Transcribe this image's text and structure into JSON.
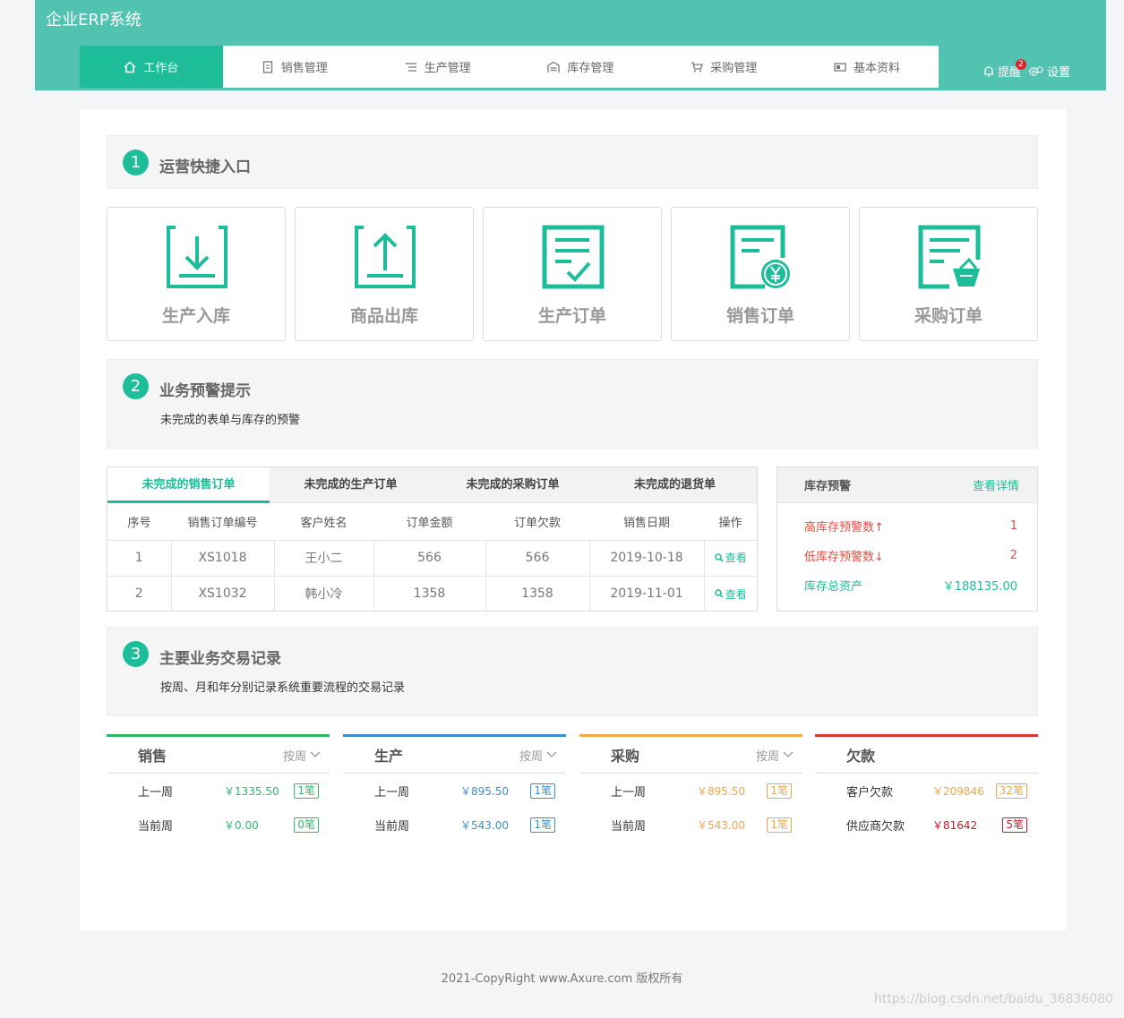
{
  "app": {
    "title": "企业ERP系统"
  },
  "nav": {
    "items": [
      {
        "label": "工作台",
        "icon": "home-icon"
      },
      {
        "label": "销售管理",
        "icon": "document-icon"
      },
      {
        "label": "生产管理",
        "icon": "list-icon"
      },
      {
        "label": "库存管理",
        "icon": "warehouse-icon"
      },
      {
        "label": "采购管理",
        "icon": "cart-icon"
      },
      {
        "label": "基本资料",
        "icon": "card-icon"
      }
    ],
    "remind_label": "提醒",
    "remind_count": "2",
    "settings_label": "设置"
  },
  "section1": {
    "num": "1",
    "title": "运营快捷入口"
  },
  "shortcuts": [
    {
      "label": "生产入库",
      "icon": "inbound-icon"
    },
    {
      "label": "商品出库",
      "icon": "outbound-icon"
    },
    {
      "label": "生产订单",
      "icon": "production-order-icon"
    },
    {
      "label": "销售订单",
      "icon": "sales-order-icon"
    },
    {
      "label": "采购订单",
      "icon": "purchase-order-icon"
    }
  ],
  "section2": {
    "num": "2",
    "title": "业务预警提示",
    "subtitle": "未完成的表单与库存的预警"
  },
  "orders": {
    "tabs": [
      "未完成的销售订单",
      "未完成的生产订单",
      "未完成的采购订单",
      "未完成的退货单"
    ],
    "columns": [
      "序号",
      "销售订单编号",
      "客户姓名",
      "订单金额",
      "订单欠款",
      "销售日期",
      "操作"
    ],
    "rows": [
      [
        "1",
        "XS1018",
        "王小二",
        "566",
        "566",
        "2019-10-18",
        "查看"
      ],
      [
        "2",
        "XS1032",
        "韩小冷",
        "1358",
        "1358",
        "2019-11-01",
        "查看"
      ]
    ]
  },
  "stock": {
    "title": "库存预警",
    "more": "查看详情",
    "rows": [
      {
        "label": "高库存预警数↑",
        "value": "1"
      },
      {
        "label": "低库存预警数↓",
        "value": "2"
      },
      {
        "label": "库存总资产",
        "value": "￥188135.00"
      }
    ]
  },
  "section3": {
    "num": "3",
    "title": "主要业务交易记录",
    "subtitle": "按周、月和年分别记录系统重要流程的交易记录"
  },
  "transactions": [
    {
      "title": "销售",
      "filter": "按周",
      "color": "#2db86a",
      "rows": [
        {
          "label": "上一周",
          "amount": "￥1335.50",
          "count": "1笔"
        },
        {
          "label": "当前周",
          "amount": "￥0.00",
          "count": "0笔"
        }
      ]
    },
    {
      "title": "生产",
      "filter": "按周",
      "color": "#3a8fd0",
      "rows": [
        {
          "label": "上一周",
          "amount": "￥895.50",
          "count": "1笔"
        },
        {
          "label": "当前周",
          "amount": "￥543.00",
          "count": "1笔"
        }
      ]
    },
    {
      "title": "采购",
      "filter": "按周",
      "color": "#f0a64a",
      "rows": [
        {
          "label": "上一周",
          "amount": "￥895.50",
          "count": "1笔"
        },
        {
          "label": "当前周",
          "amount": "￥543.00",
          "count": "1笔"
        }
      ]
    },
    {
      "title": "欠款",
      "filter": "",
      "color": "#d9392f",
      "rows": [
        {
          "label": "客户欠款",
          "amount": "￥209846",
          "count": "32笔",
          "color": "#f0a64a"
        },
        {
          "label": "供应商欠款",
          "amount": "￥81642",
          "count": "5笔",
          "color": "#c7192c"
        }
      ]
    }
  ],
  "footer": "2021-CopyRight www.Axure.com 版权所有",
  "watermark": "https://blog.csdn.net/baidu_36836080"
}
